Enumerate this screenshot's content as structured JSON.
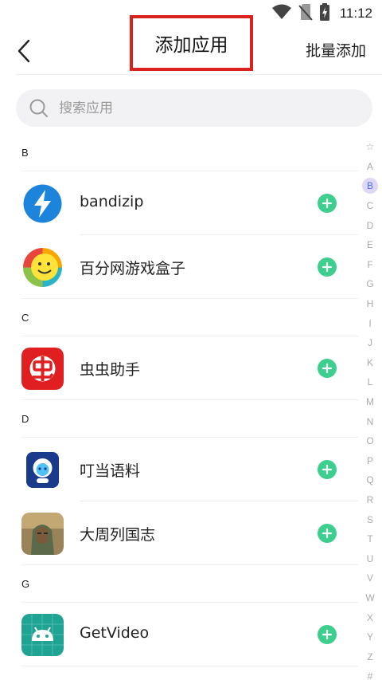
{
  "status_bar": {
    "time": "11:12"
  },
  "header": {
    "title": "添加应用",
    "bulk_add": "批量添加"
  },
  "search": {
    "placeholder": "搜索应用"
  },
  "sections": [
    {
      "letter": "B",
      "apps": [
        {
          "name": "bandizip",
          "icon": "bandizip-icon"
        },
        {
          "name": "百分网游戏盒子",
          "icon": "baifenwang-icon"
        }
      ]
    },
    {
      "letter": "C",
      "apps": [
        {
          "name": "虫虫助手",
          "icon": "chongchong-icon"
        }
      ]
    },
    {
      "letter": "D",
      "apps": [
        {
          "name": "叮当语料",
          "icon": "dingdang-icon"
        },
        {
          "name": "大周列国志",
          "icon": "dazhou-icon"
        }
      ]
    },
    {
      "letter": "G",
      "apps": [
        {
          "name": "GetVideo",
          "icon": "getvideo-icon"
        }
      ]
    }
  ],
  "index_bar": [
    "☆",
    "A",
    "B",
    "C",
    "D",
    "E",
    "F",
    "G",
    "H",
    "I",
    "J",
    "K",
    "L",
    "M",
    "N",
    "O",
    "P",
    "Q",
    "R",
    "S",
    "T",
    "U",
    "V",
    "W",
    "X",
    "Y",
    "Z",
    "#"
  ],
  "index_active": "B",
  "colors": {
    "accent_green": "#3ecf8e",
    "highlight_red": "#d9211e",
    "index_active": "#4a6cf7"
  }
}
